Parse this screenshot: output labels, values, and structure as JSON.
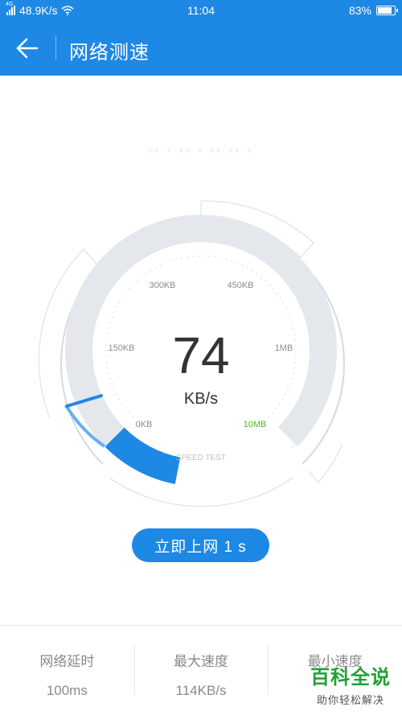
{
  "status_bar": {
    "network_type": "4G",
    "net_speed": "48.9K/s",
    "time": "11:04",
    "battery": "83%",
    "battery_level": 0.83
  },
  "header": {
    "title": "网络测速",
    "back_icon": "arrow-left-icon"
  },
  "gauge": {
    "value": "74",
    "unit": "KB/s",
    "caption": "SPEED TEST",
    "level": 0.0,
    "ticks": [
      "0KB",
      "150KB",
      "300KB",
      "450KB",
      "1MB",
      "10MB"
    ],
    "accent_color": "#1e88e5",
    "tick_highlight_color": "#52b51e"
  },
  "action": {
    "button_label": "立即上网 1 s"
  },
  "stats": [
    {
      "label": "网络延时",
      "value": "100ms"
    },
    {
      "label": "最大速度",
      "value": "114KB/s"
    },
    {
      "label": "最小速度",
      "value": ""
    }
  ],
  "watermark": {
    "main": "百科全说",
    "sub": "助你轻松解决"
  },
  "colors": {
    "primary": "#1e88e5",
    "track": "#e4e7ec"
  }
}
